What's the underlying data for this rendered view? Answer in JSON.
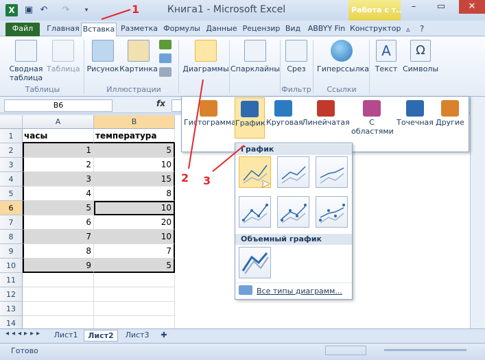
{
  "window": {
    "title": "Книга1  -  Microsoft Excel",
    "context_tab": "Работа с т...",
    "app_icon": "X"
  },
  "tabs": [
    "Файл",
    "Главная",
    "Вставка",
    "Разметка",
    "Формулы",
    "Данные",
    "Рецензир",
    "Вид",
    "ABBYY Fin",
    "Конструктор"
  ],
  "ribbon": {
    "tables": {
      "pivot": "Сводная\nтаблица",
      "table": "Таблица",
      "group": "Таблицы"
    },
    "illustrations": {
      "picture": "Рисунок",
      "clipart": "Картинка",
      "group": "Иллюстрации"
    },
    "charts": {
      "label": "Диаграммы"
    },
    "sparklines": {
      "label": "Спарклайны"
    },
    "filter": {
      "slicer": "Срез",
      "group": "Фильтр"
    },
    "links": {
      "hyperlink": "Гиперссылка",
      "group": "Ссылки"
    },
    "text": {
      "label": "Текст"
    },
    "symbols": {
      "label": "Символы"
    }
  },
  "formula_bar": {
    "name_box": "B6",
    "fx": "fx",
    "value": ""
  },
  "columns": [
    "A",
    "B"
  ],
  "rows": [
    1,
    2,
    3,
    4,
    5,
    6,
    7,
    8,
    9,
    10,
    11,
    12,
    13,
    14
  ],
  "table": {
    "headers": [
      "часы",
      "температура"
    ],
    "data": [
      [
        "1",
        "5"
      ],
      [
        "2",
        "10"
      ],
      [
        "3",
        "15"
      ],
      [
        "4",
        "8"
      ],
      [
        "5",
        "10"
      ],
      [
        "6",
        "20"
      ],
      [
        "7",
        "10"
      ],
      [
        "8",
        "7"
      ],
      [
        "9",
        "5"
      ]
    ]
  },
  "chart_menu": {
    "types": [
      "Гистограмма",
      "График",
      "Круговая",
      "Линейчатая",
      "С\nобластями",
      "Точечная",
      "Другие"
    ],
    "section_line": "График",
    "section_3d": "Объемный график",
    "all_types": "Все типы диаграмм..."
  },
  "sheets": [
    "Лист1",
    "Лист2",
    "Лист3"
  ],
  "status": "Готово",
  "annotations": [
    "1",
    "2",
    "3"
  ],
  "colors": {
    "annotation": "#e4262c",
    "file_tab": "#2a6b2e",
    "selected": "#fde7a6"
  }
}
